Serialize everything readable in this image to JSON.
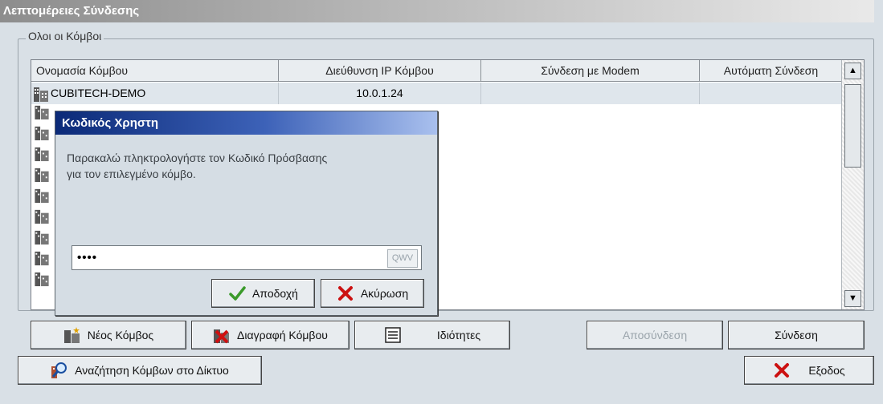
{
  "window": {
    "title": "Λεπτομέρειες Σύνδεσης"
  },
  "group": {
    "label": "Ολοι οι Κόμβοι"
  },
  "grid": {
    "columns": [
      "Ονομασία Κόμβου",
      "Διεύθυνση IP Κόμβου",
      "Σύνδεση με Modem",
      "Αυτόματη Σύνδεση"
    ],
    "rows": [
      {
        "name": "CUBITECH-DEMO",
        "ip": "10.0.1.24",
        "modem": "",
        "auto": ""
      }
    ]
  },
  "buttons": {
    "new_node": "Νέος Κόμβος",
    "delete_node": "Διαγραφή Κόμβου",
    "properties": "Ιδιότητες",
    "disconnect": "Αποσύνδεση",
    "connect": "Σύνδεση",
    "search": "Αναζήτηση Κόμβων στο Δίκτυο",
    "exit": "Εξοδος"
  },
  "dialog": {
    "title": "Κωδικός Χρηστη",
    "message_line1": "Παρακαλώ πληκτρολογήστε τον Κωδικό Πρόσβασης",
    "message_line2": "για τον επιλεγμένο κόμβο.",
    "password_value": "••••",
    "keyboard_label": "QWV",
    "ok": "Αποδοχή",
    "cancel": "Ακύρωση"
  },
  "colors": {
    "accept_icon": "#3a9a2a",
    "cancel_icon": "#cc1111",
    "dialog_title_start": "#0b2a78"
  }
}
